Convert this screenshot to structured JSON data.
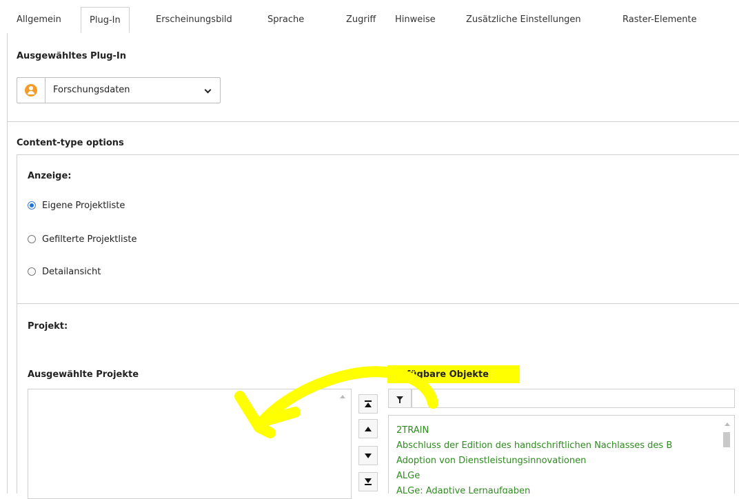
{
  "tabs": [
    {
      "label": "Allgemein",
      "active": false
    },
    {
      "label": "Plug-In",
      "active": true
    },
    {
      "label": "Erscheinungsbild",
      "active": false
    },
    {
      "label": "Sprache",
      "active": false
    },
    {
      "label": "Zugriff",
      "active": false
    },
    {
      "label": "Hinweise",
      "active": false
    },
    {
      "label": "Zusätzliche Einstellungen",
      "active": false
    },
    {
      "label": "Raster-Elemente",
      "active": false
    }
  ],
  "plugin": {
    "heading": "Ausgewähltes Plug-In",
    "selected": "Forschungsdaten"
  },
  "content_type": {
    "heading": "Content-type options"
  },
  "display": {
    "heading": "Anzeige:",
    "options": [
      {
        "label": "Eigene Projektliste",
        "checked": true
      },
      {
        "label": "Gefilterte Projektliste",
        "checked": false
      },
      {
        "label": "Detailansicht",
        "checked": false
      }
    ]
  },
  "project": {
    "heading": "Projekt:",
    "selected_heading": "Ausgewählte Projekte",
    "available_heading": "Verfügbare Objekte",
    "filter_value": "",
    "available_items": [
      "2TRAIN",
      "Abschluss der Edition des handschriftlichen Nachlasses des B",
      "Adoption von Dienstleistungsinnovationen",
      "ALGe",
      "ALGe: Adaptive Lernaufgaben"
    ]
  },
  "colors": {
    "accent": "#1e73d8",
    "item_text": "#2e8b1f",
    "highlight": "#ffff00",
    "plugin_icon": "#f39c2a"
  }
}
